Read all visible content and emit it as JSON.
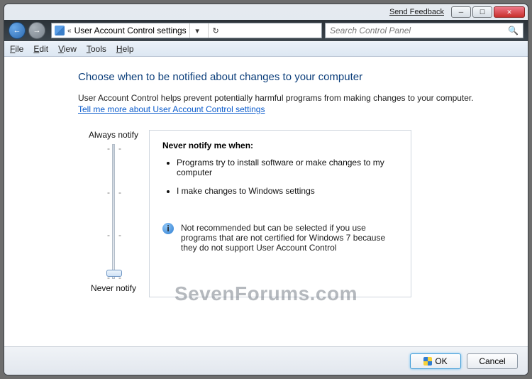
{
  "titlebar": {
    "feedback": "Send Feedback"
  },
  "nav": {
    "address": "User Account Control settings",
    "search_placeholder": "Search Control Panel"
  },
  "menu": {
    "file": "File",
    "edit": "Edit",
    "view": "View",
    "tools": "Tools",
    "help": "Help"
  },
  "heading": "Choose when to be notified about changes to your computer",
  "desc": "User Account Control helps prevent potentially harmful programs from making changes to your computer.",
  "link": "Tell me more about User Account Control settings",
  "slider": {
    "top": "Always notify",
    "bottom": "Never notify"
  },
  "panel": {
    "title": "Never notify me when:",
    "items": [
      "Programs try to install software or make changes to my computer",
      "I make changes to Windows settings"
    ],
    "note": "Not recommended but can be selected if you use programs that are not certified for Windows 7 because they do not support User Account Control"
  },
  "buttons": {
    "ok": "OK",
    "cancel": "Cancel"
  },
  "watermark": "SevenForums.com"
}
